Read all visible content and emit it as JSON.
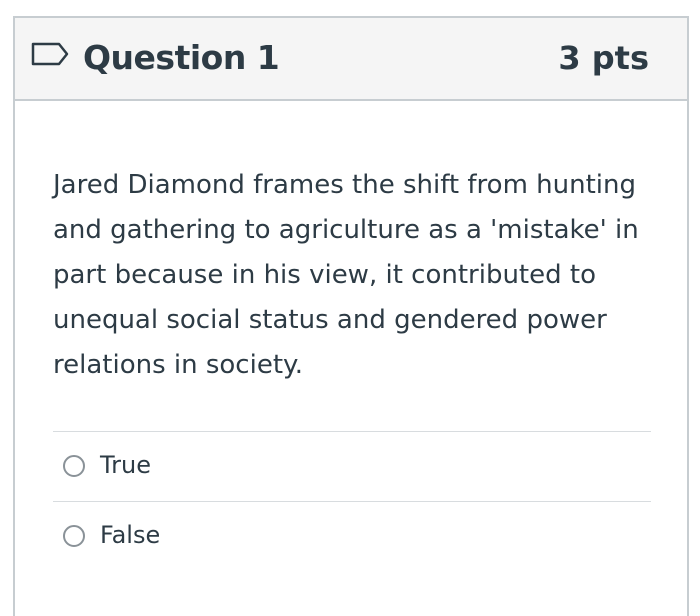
{
  "question": {
    "title": "Question 1",
    "points": "3 pts",
    "text": "Jared Diamond frames the shift from hunting and gathering to agriculture as a 'mistake' in part because in his view, it contributed to unequal social status and gendered power relations in society.",
    "flag_icon": "flag-outline-icon"
  },
  "answers": [
    {
      "label": "True",
      "selected": false
    },
    {
      "label": "False",
      "selected": false
    }
  ],
  "colors": {
    "text": "#2d3b45",
    "header_bg": "#f5f5f5",
    "border": "#c7cdd1"
  }
}
